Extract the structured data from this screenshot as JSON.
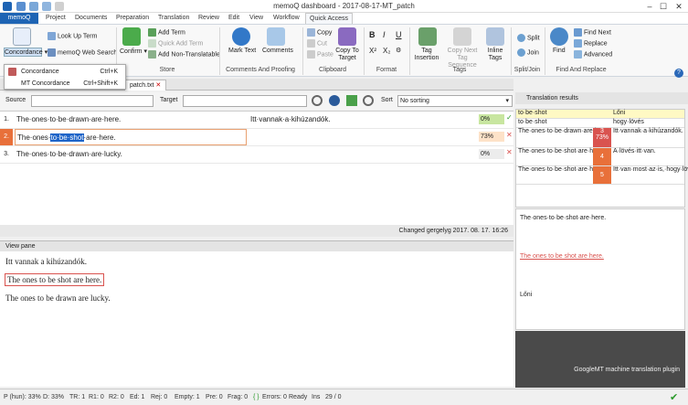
{
  "window": {
    "title": "memoQ dashboard - 2017-08-17-MT_patch",
    "controls": [
      "–",
      "☐",
      "✕"
    ]
  },
  "ribbon_tabs": [
    "memoQ",
    "Project",
    "Documents",
    "Preparation",
    "Translation",
    "Review",
    "Edit",
    "View",
    "Workflow",
    "Quick Access"
  ],
  "ribbon": {
    "concordance": "Concordance",
    "look_up_term": "Look Up Term",
    "memoq_web_search": "memoQ Web Search",
    "confirm": "Confirm",
    "add_term": "Add Term",
    "quick_add_term": "Quick Add Term",
    "add_non_translatable": "Add Non-Translatable",
    "mark_text": "Mark Text",
    "comments": "Comments",
    "copy": "Copy",
    "cut": "Cut",
    "paste": "Paste",
    "copy_to_target": "Copy To Target",
    "tag_insertion": "Tag Insertion",
    "copy_next_tag_sequence": "Copy Next Tag Sequence",
    "inline_tags": "Inline Tags",
    "split": "Split",
    "join": "Join",
    "find": "Find",
    "find_next": "Find Next",
    "replace": "Replace",
    "advanced": "Advanced",
    "groups": {
      "store": "Store",
      "comments_proofing": "Comments And Proofing",
      "clipboard": "Clipboard",
      "format": "Format",
      "tags": "Tags",
      "split_join": "Split/Join",
      "find_replace": "Find And Replace"
    }
  },
  "dropdown": [
    {
      "label": "Concordance",
      "shortcut": "Ctrl+K"
    },
    {
      "label": "MT Concordance",
      "shortcut": "Ctrl+Shift+K"
    }
  ],
  "doc_tab": {
    "label": "patch.txt",
    "close": "✕"
  },
  "filter": {
    "source_label": "Source",
    "target_label": "Target",
    "sort_label": "Sort",
    "sort_value": "No sorting"
  },
  "segments": [
    {
      "num": "1.",
      "src_a": "The·ones·to·be·drawn·are·here.",
      "src_hl": "",
      "src_b": "",
      "tgt": "Itt·vannak·a·kihúzandók.",
      "pct": "0%",
      "pct_color": "#c8e6a0",
      "status": "✓"
    },
    {
      "num": "2.",
      "src_a": "The·ones·",
      "src_hl": "to·be·shot",
      "src_b": "·are·here.",
      "tgt": "",
      "pct": "73%",
      "pct_color": "#fde2c8",
      "status": "✕"
    },
    {
      "num": "3.",
      "src_a": "The·ones·to·be·drawn·are·lucky.",
      "src_hl": "",
      "src_b": "",
      "tgt": "",
      "pct": "0%",
      "pct_color": "#ececec",
      "status": "✕"
    }
  ],
  "grid_status": "Changed  gergelyg 2017. 08. 17. 16:26",
  "view_pane": {
    "header": "View pane",
    "lines": [
      "Itt vannak a kihúzandók.",
      "The ones to be shot are here.",
      "The ones to be drawn are lucky."
    ]
  },
  "translation_results": {
    "header": "Translation results",
    "rows": [
      {
        "src": "to·be·shot",
        "num": "",
        "tgt": "Lőni"
      },
      {
        "src": "to·be·shot",
        "num": "",
        "tgt": "hogy·lövés"
      },
      {
        "src": "The·ones·to·be·drawn·are·here.",
        "num": "3\n73%",
        "tgt": "Itt·vannak·a·kihúzandók."
      },
      {
        "src": "The·ones·to·be·shot·are·here.",
        "num": "4",
        "tgt": "A·lövés·itt·van."
      },
      {
        "src": "The·ones·to·be·shot·are·here.",
        "num": "5",
        "tgt": "Itt·van·most·az·is,·hogy·lövés."
      }
    ],
    "compare_src": "The·ones·to·be·shot·are·here.",
    "compare_diff": "The ones to be shot are here.",
    "compare_tgt": "Lőni",
    "mt_caption": "GoogleMT machine translation plugin"
  },
  "status_bar": {
    "p_hun": "P (hun): 33%",
    "d": "D: 33%",
    "tr": "TR: 1",
    "r1": "R1: 0",
    "r2": "R2: 0",
    "ed": "Ed: 1",
    "rej": "Rej: 0",
    "empty": "Empty: 1",
    "pre": "Pre: 0",
    "frag": "Frag: 0",
    "errors": "Errors: 0",
    "ready": "Ready",
    "ins": "Ins",
    "pos": "29 / 0"
  },
  "colors": {
    "accent": "#1e64b4",
    "highlight": "#1e64c8",
    "match_orange": "#e8703a",
    "match_red": "#d9534f"
  }
}
